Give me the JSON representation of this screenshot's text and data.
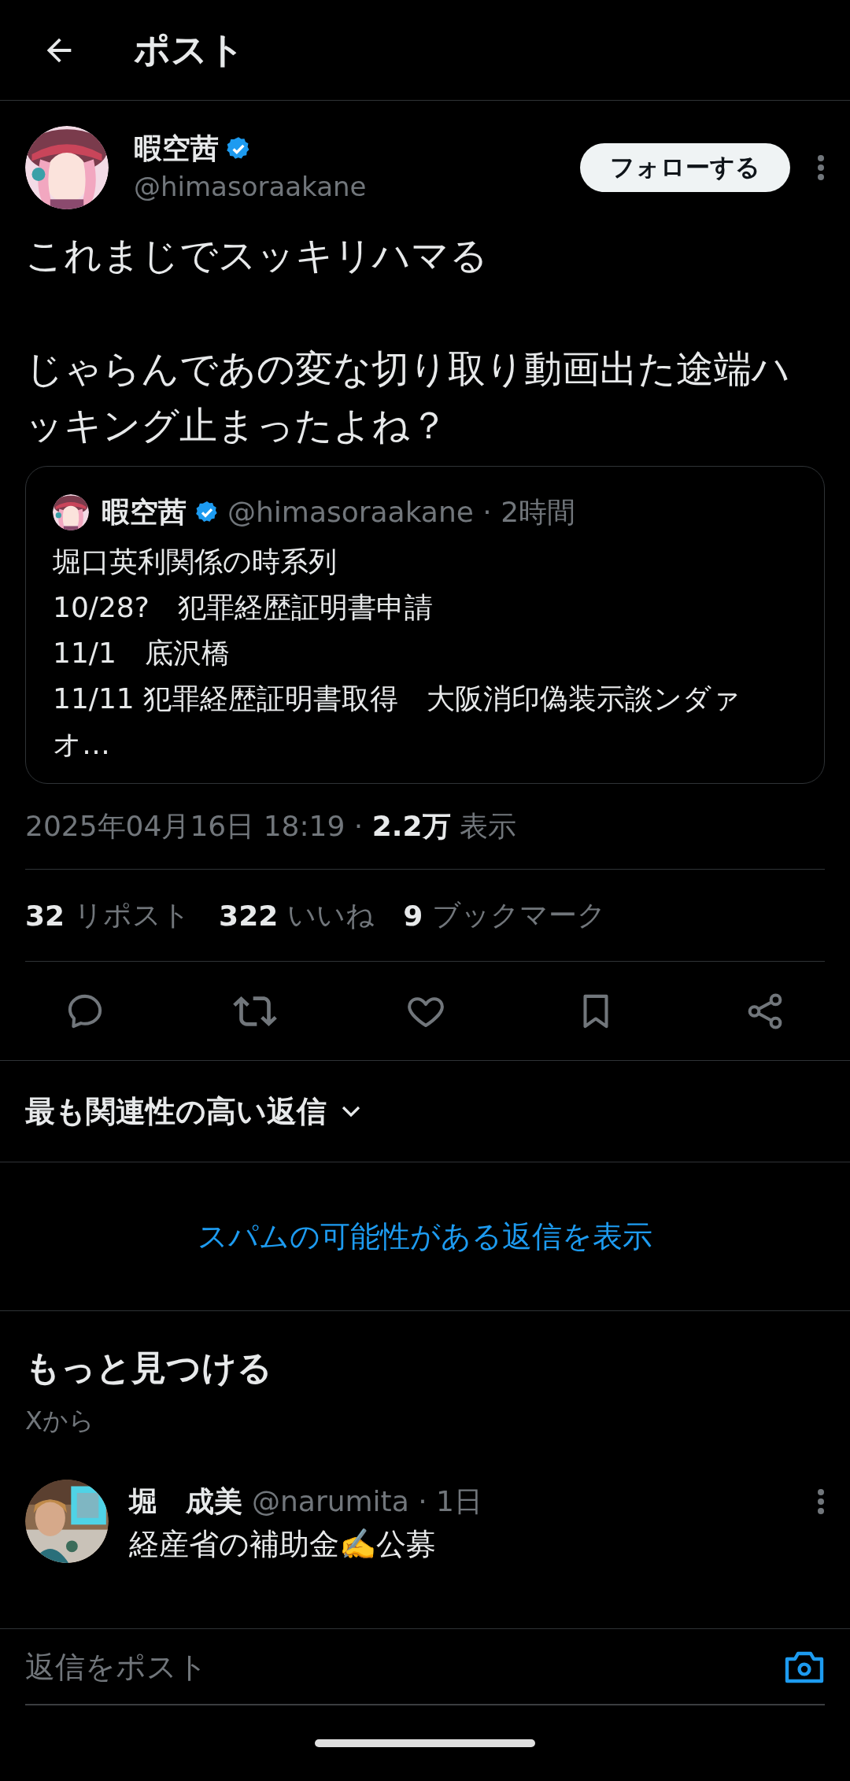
{
  "header": {
    "title": "ポスト"
  },
  "post": {
    "author": {
      "name": "暇空茜",
      "verified": true,
      "handle": "@himasoraakane"
    },
    "follow_button": "フォローする",
    "paragraphs": [
      "これまじでスッキリハマる",
      "じゃらんであの変な切り取り動画出た途端ハッキング止まったよね？"
    ],
    "quote": {
      "name": "暇空茜",
      "verified": true,
      "meta": "@himasoraakane · 2時間",
      "lines": [
        "堀口英利関係の時系列",
        "10/28?　犯罪経歴証明書申請",
        "11/1　底沢橋",
        "11/11 犯罪経歴証明書取得　大阪消印偽装示談ンダァオ…"
      ]
    },
    "timestamp": "2025年04月16日 18:19 · **2.2万** 表示",
    "stats": [
      {
        "count": "32",
        "label": "リポスト"
      },
      {
        "count": "322",
        "label": "いいね"
      },
      {
        "count": "9",
        "label": "ブックマーク"
      }
    ],
    "actions": [
      {
        "kind": "reply"
      },
      {
        "kind": "repost"
      },
      {
        "kind": "like"
      },
      {
        "kind": "bookmark"
      },
      {
        "kind": "share"
      }
    ]
  },
  "reply_sort": {
    "label": "最も関連性の高い返信"
  },
  "spam_link": "スパムの可能性がある返信を表示",
  "discover": {
    "title": "もっと見つける",
    "subtitle": "Xから",
    "posts": [
      {
        "name": "堀　成美",
        "meta": "@narumita · 1日",
        "text": "経産省の補助金✍️公募"
      }
    ]
  },
  "reply_bar": {
    "placeholder": "返信をポスト"
  }
}
